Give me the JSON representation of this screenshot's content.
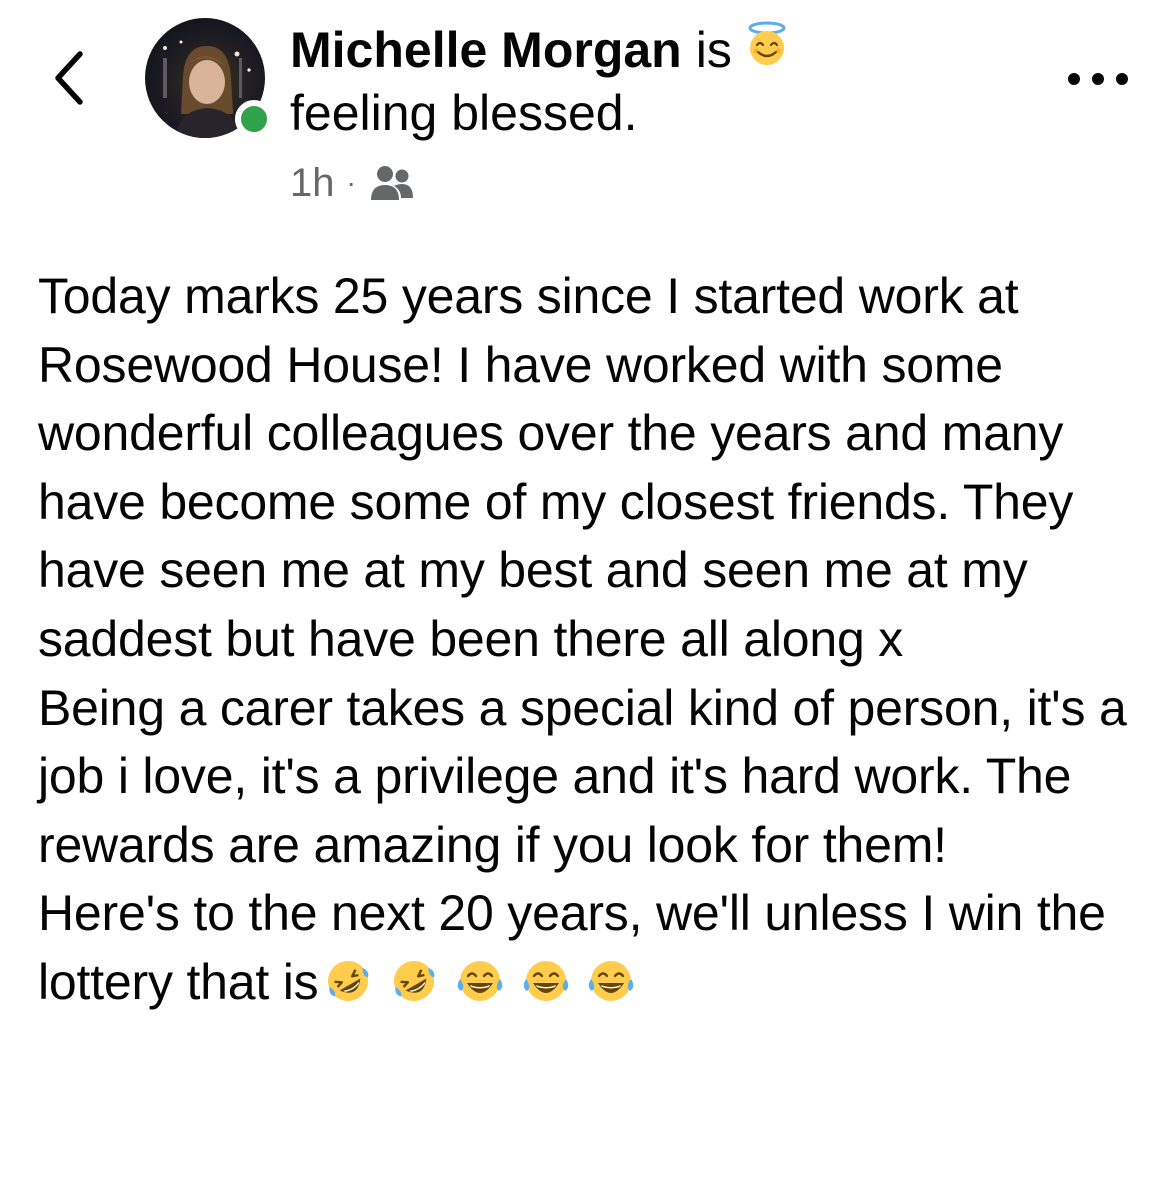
{
  "header": {
    "back_icon": "chevron-left-icon",
    "author_name": "Michelle Morgan",
    "status_verb": "is",
    "feeling_emoji": "smiling-face-with-halo",
    "feeling_text": "feeling blessed.",
    "timestamp": "1h",
    "separator": "·",
    "audience_icon": "friends-icon",
    "more_icon": "more-options-icon"
  },
  "post": {
    "paragraphs": [
      "Today marks 25 years since I started work at Rosewood House! I have worked with some wonderful colleagues over the years and many have become some of my closest friends. They have seen me at my best and seen me at my saddest but have been there all along x",
      "Being a carer takes a special kind of person, it's a job i love, it's a privilege and it's hard work. The rewards are amazing if you look for them!",
      "Here's to the next 20 years, we'll unless I win the lottery that is"
    ],
    "closing_emojis": [
      "rolling-on-floor-laughing",
      "rolling-on-floor-laughing",
      "face-with-tears-of-joy",
      "face-with-tears-of-joy",
      "face-with-tears-of-joy"
    ]
  },
  "colors": {
    "online": "#31a24c",
    "meta_text": "#65676b",
    "emoji_yellow": "#ffcc4d"
  }
}
